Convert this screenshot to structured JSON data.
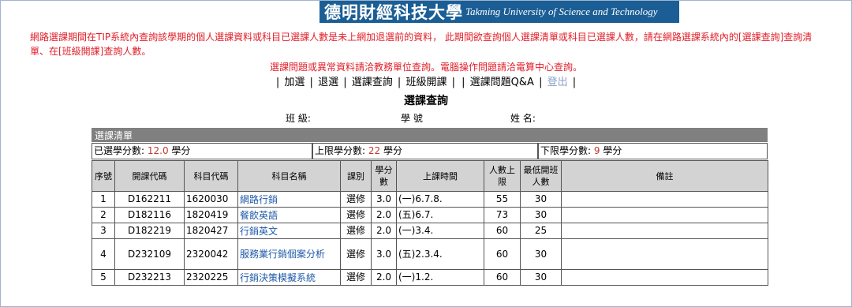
{
  "banner": {
    "title_cn": "德明財經科技大學",
    "title_en": "Takming University of Science and Technology"
  },
  "notice": {
    "line1": "網路選課期間在TIP系統內查詢該學期的個人選課資料或科目已選課人數是未上網加退選前的資料， 此期間欲查詢個人選課清單或科目已選課人數，請在網路選課系統內的[選課查詢]查詢清單、在[班級開課]查詢人數。",
    "line2": "選課問題或異常資料請洽教務單位查詢。電腦操作問題請洽電算中心查詢。"
  },
  "nav": {
    "items": [
      "加選",
      "退選",
      "選課查詢",
      "班級開課",
      "選課問題Q&A",
      "登出"
    ]
  },
  "page": {
    "title": "選課查詢",
    "class_label": "班 級:",
    "student_id_label": "學 號",
    "name_label": "姓 名:"
  },
  "list": {
    "header": "選課清單",
    "selected_label": "已選學分數:",
    "selected_value": "12.0",
    "upper_label": "上限學分數:",
    "upper_value": "22",
    "lower_label": "下限學分數:",
    "lower_value": "9",
    "unit": "學分"
  },
  "table": {
    "headers": [
      "序號",
      "開課代碼",
      "科目代碼",
      "科目名稱",
      "課別",
      "學分數",
      "上課時間",
      "人數上限",
      "最低開班人數",
      "備註"
    ],
    "rows": [
      {
        "no": "1",
        "offer": "D162211",
        "code": "1620030",
        "name": "網路行銷",
        "type": "選修",
        "credit": "3.0",
        "time": "(一)6.7.8.",
        "max": "55",
        "min": "30",
        "note": ""
      },
      {
        "no": "2",
        "offer": "D182116",
        "code": "1820419",
        "name": "餐飲英語",
        "type": "選修",
        "credit": "2.0",
        "time": "(五)6.7.",
        "max": "73",
        "min": "30",
        "note": ""
      },
      {
        "no": "3",
        "offer": "D182219",
        "code": "1820427",
        "name": "行銷英文",
        "type": "選修",
        "credit": "2.0",
        "time": "(一)3.4.",
        "max": "60",
        "min": "25",
        "note": ""
      },
      {
        "no": "4",
        "offer": "D232109",
        "code": "2320042",
        "name": "服務業行銷個案分析",
        "type": "選修",
        "credit": "3.0",
        "time": "(五)2.3.4.",
        "max": "60",
        "min": "30",
        "note": ""
      },
      {
        "no": "5",
        "offer": "D232213",
        "code": "2320225",
        "name": "行銷決策模擬系統",
        "type": "選修",
        "credit": "2.0",
        "time": "(一)1.2.",
        "max": "60",
        "min": "30",
        "note": ""
      }
    ]
  }
}
